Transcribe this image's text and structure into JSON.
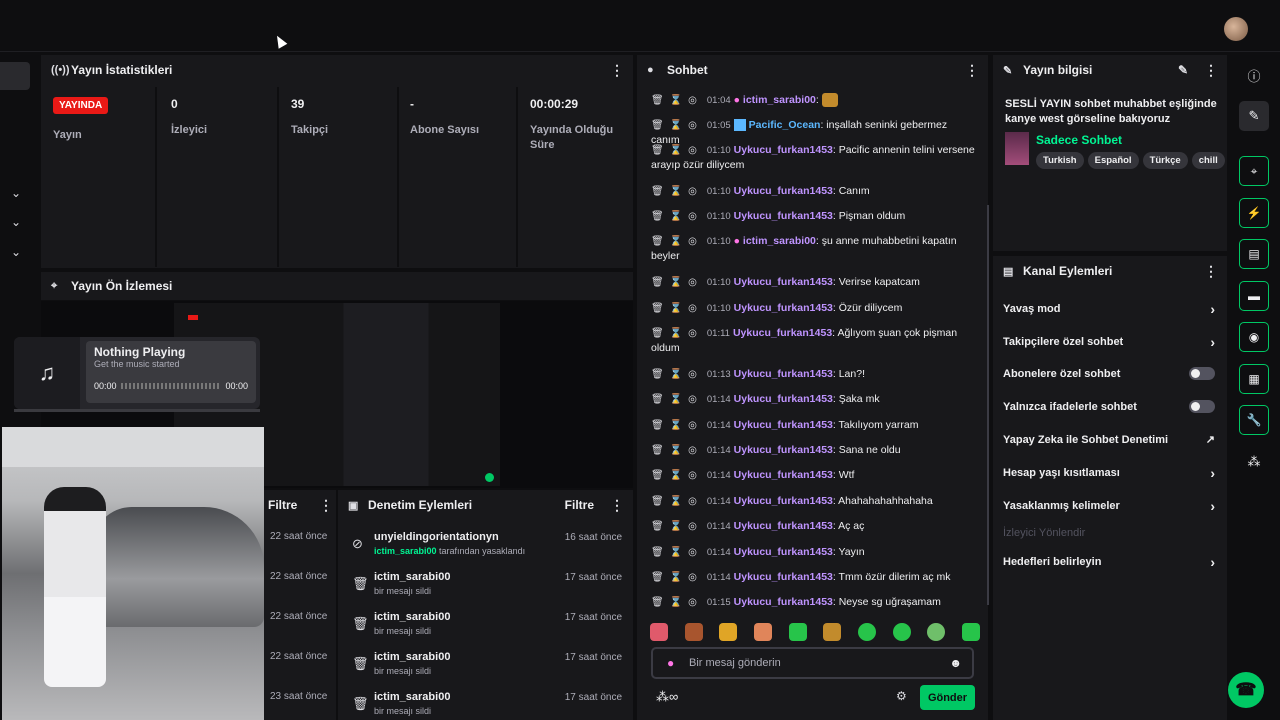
{
  "stats_panel": {
    "title": "Yayın İstatistikleri",
    "live_badge": "YAYINDA",
    "items": [
      {
        "value": "",
        "label": "Yayın"
      },
      {
        "value": "0",
        "label": "İzleyici"
      },
      {
        "value": "39",
        "label": "Takipçi"
      },
      {
        "value": "-",
        "label": "Abone Sayısı"
      },
      {
        "value": "00:00:29",
        "label": "Yayında Olduğu Süre"
      }
    ]
  },
  "preview_panel": {
    "title": "Yayın Ön İzlemesi",
    "music": {
      "title": "Nothing Playing",
      "subtitle": "Get the music started",
      "time_start": "00:00",
      "time_end": "00:00"
    }
  },
  "filter_panel": {
    "filter_label": "Filtre",
    "times": [
      "22 saat önce",
      "22 saat önce",
      "22 saat önce",
      "22 saat önce",
      "23 saat önce"
    ]
  },
  "moderation_panel": {
    "title": "Denetim Eylemleri",
    "filter_label": "Filtre",
    "rows": [
      {
        "icon": "ban-icon",
        "name": "unyieldingorientationyn",
        "actor": "ictim_sarabi00",
        "action": " tarafından yasaklandı",
        "time": "16 saat önce"
      },
      {
        "icon": "trash-icon",
        "name": "ictim_sarabi00",
        "actor": "",
        "action": "bir mesajı sildi",
        "time": "17 saat önce"
      },
      {
        "icon": "trash-icon",
        "name": "ictim_sarabi00",
        "actor": "",
        "action": "bir mesajı sildi",
        "time": "17 saat önce"
      },
      {
        "icon": "trash-icon",
        "name": "ictim_sarabi00",
        "actor": "",
        "action": "bir mesajı sildi",
        "time": "17 saat önce"
      },
      {
        "icon": "trash-icon",
        "name": "ictim_sarabi00",
        "actor": "",
        "action": "bir mesajı sildi",
        "time": "17 saat önce"
      }
    ]
  },
  "chat_panel": {
    "title": "Sohbet",
    "messages": [
      {
        "time": "01:04",
        "user": "ictim_sarabi00",
        "color": "#bf94ff",
        "mic": true,
        "text": ""
      },
      {
        "time": "01:05",
        "user": "Pacific_Ocean",
        "color": "#5cb8ff",
        "mic": false,
        "text": "inşallah seninki gebermez canım"
      },
      {
        "time": "01:10",
        "user": "Uykucu_furkan1453",
        "color": "#bf94ff",
        "mic": false,
        "text": "Pacific annenin telini versene arayıp özür diliycem"
      },
      {
        "time": "01:10",
        "user": "Uykucu_furkan1453",
        "color": "#bf94ff",
        "mic": false,
        "text": "Canım"
      },
      {
        "time": "01:10",
        "user": "Uykucu_furkan1453",
        "color": "#bf94ff",
        "mic": false,
        "text": "Pişman oldum"
      },
      {
        "time": "01:10",
        "user": "ictim_sarabi00",
        "color": "#bf94ff",
        "mic": true,
        "text": "şu anne muhabbetini kapatın beyler"
      },
      {
        "time": "01:10",
        "user": "Uykucu_furkan1453",
        "color": "#bf94ff",
        "mic": false,
        "text": "Verirse kapatcam"
      },
      {
        "time": "01:10",
        "user": "Uykucu_furkan1453",
        "color": "#bf94ff",
        "mic": false,
        "text": "Özür diliycem"
      },
      {
        "time": "01:11",
        "user": "Uykucu_furkan1453",
        "color": "#bf94ff",
        "mic": false,
        "text": "Ağlıyom şuan çok pişman oldum"
      },
      {
        "time": "01:13",
        "user": "Uykucu_furkan1453",
        "color": "#bf94ff",
        "mic": false,
        "text": "Lan?!"
      },
      {
        "time": "01:14",
        "user": "Uykucu_furkan1453",
        "color": "#bf94ff",
        "mic": false,
        "text": "Şaka mk"
      },
      {
        "time": "01:14",
        "user": "Uykucu_furkan1453",
        "color": "#bf94ff",
        "mic": false,
        "text": "Takılıyom yarram"
      },
      {
        "time": "01:14",
        "user": "Uykucu_furkan1453",
        "color": "#bf94ff",
        "mic": false,
        "text": "Sana ne oldu"
      },
      {
        "time": "01:14",
        "user": "Uykucu_furkan1453",
        "color": "#bf94ff",
        "mic": false,
        "text": "Wtf"
      },
      {
        "time": "01:14",
        "user": "Uykucu_furkan1453",
        "color": "#bf94ff",
        "mic": false,
        "text": "Ahahahahahhahaha"
      },
      {
        "time": "01:14",
        "user": "Uykucu_furkan1453",
        "color": "#bf94ff",
        "mic": false,
        "text": "Aç aç"
      },
      {
        "time": "01:14",
        "user": "Uykucu_furkan1453",
        "color": "#bf94ff",
        "mic": false,
        "text": "Yayın"
      },
      {
        "time": "01:14",
        "user": "Uykucu_furkan1453",
        "color": "#bf94ff",
        "mic": false,
        "text": "Tmm özür dilerim aç mk"
      },
      {
        "time": "01:15",
        "user": "Uykucu_furkan1453",
        "color": "#bf94ff",
        "mic": false,
        "text": "Neyse sg uğraşamam"
      }
    ],
    "input_placeholder": "Bir mesaj gönderin",
    "send_label": "Gönder"
  },
  "info_panel": {
    "title": "Yayın bilgisi",
    "stream_title": "SESLİ YAYIN sohbet muhabbet eşliğinde kanye west görseline bakıyoruz",
    "category": "Sadece Sohbet",
    "tags": [
      "Turkish",
      "Español",
      "Türkçe",
      "chill"
    ]
  },
  "channel_actions": {
    "title": "Kanal Eylemleri",
    "items": [
      {
        "label": "Yavaş mod",
        "control": "arrow"
      },
      {
        "label": "Takipçilere özel sohbet",
        "control": "arrow"
      },
      {
        "label": "Abonelere özel sohbet",
        "control": "toggle"
      },
      {
        "label": "Yalnızca ifadelerle sohbet",
        "control": "toggle"
      },
      {
        "label": "Yapay Zeka ile Sohbet Denetimi",
        "control": "external"
      },
      {
        "label": "Hesap yaşı kısıtlaması",
        "control": "arrow"
      },
      {
        "label": "Yasaklanmış kelimeler",
        "control": "arrow"
      },
      {
        "label": "İzleyici Yönlendir",
        "control": "disabled"
      },
      {
        "label": "Hedefleri belirleyin",
        "control": "arrow"
      }
    ]
  },
  "colors": {
    "accent": "#00c864",
    "live": "#e91916",
    "panel": "#18181b",
    "bg": "#0e0e10"
  }
}
